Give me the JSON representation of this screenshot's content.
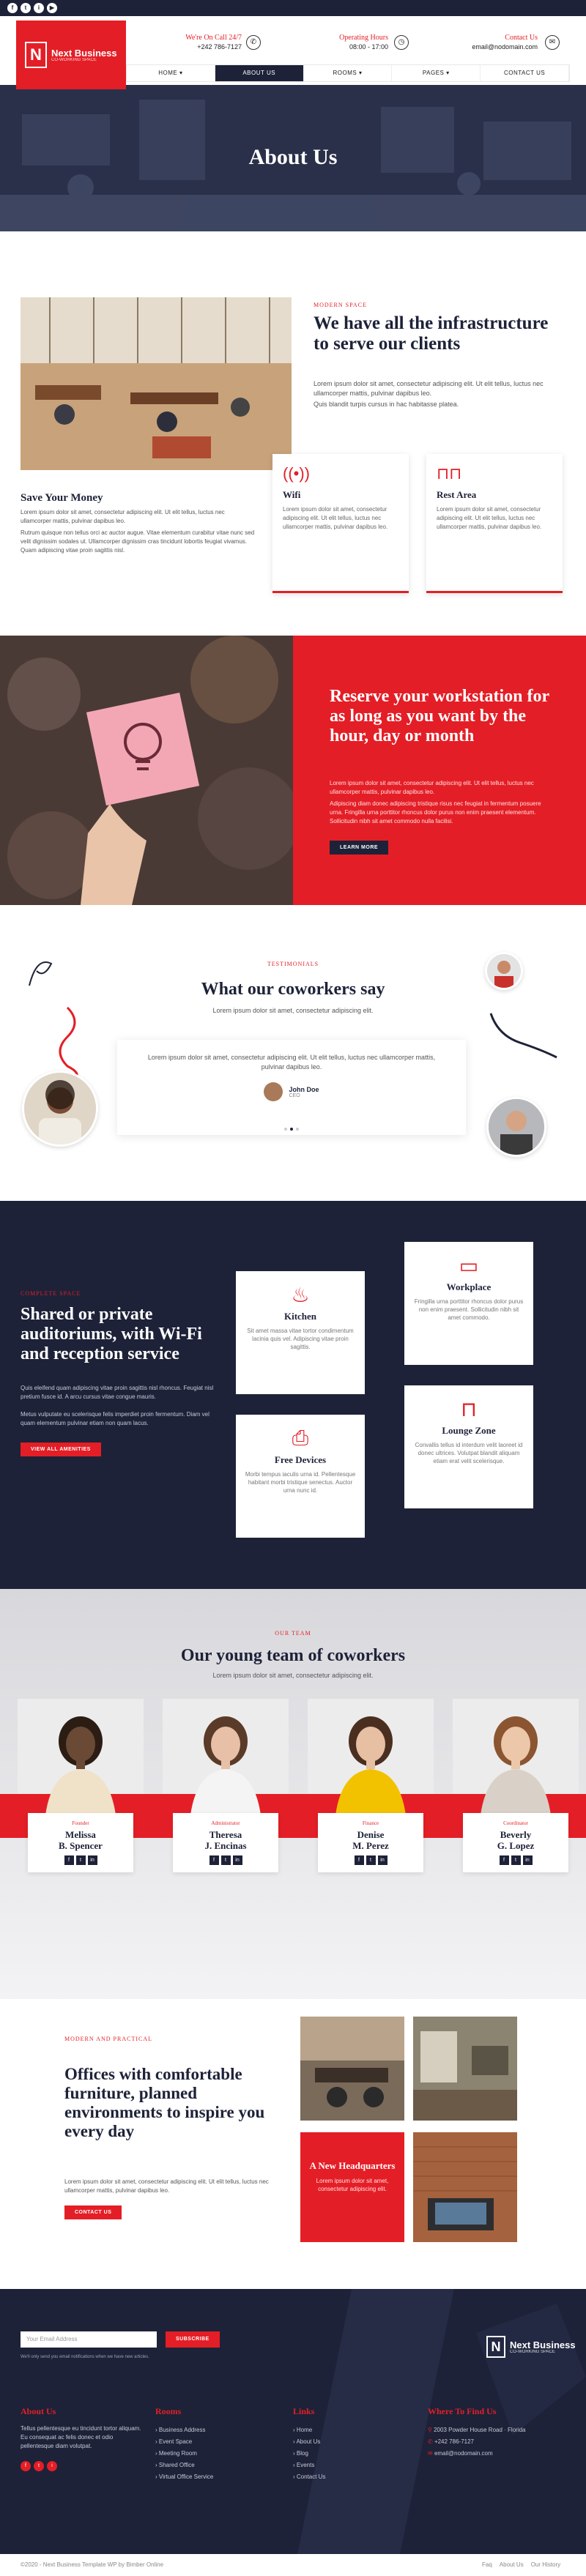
{
  "topbar": {
    "social": [
      "f",
      "t",
      "i",
      "▶"
    ]
  },
  "header": {
    "logo": {
      "title": "Next Business",
      "subtitle": "CO-WORKING SPACE"
    },
    "call": {
      "label": "We're On Call 24/7",
      "value": "+242 786-7127"
    },
    "hours": {
      "label": "Operating Hours",
      "value": "08:00 - 17:00"
    },
    "contact": {
      "label": "Contact Us",
      "value": "email@nodomain.com"
    },
    "nav": [
      {
        "label": "HOME ▾"
      },
      {
        "label": "ABOUT US"
      },
      {
        "label": "ROOMS ▾"
      },
      {
        "label": "PAGES ▾"
      },
      {
        "label": "CONTACT US"
      }
    ]
  },
  "hero": {
    "title": "About Us"
  },
  "infra": {
    "eyebrow": "MODERN SPACE",
    "title": "We have all the infrastructure to serve our clients",
    "p1": "Lorem ipsum dolor sit amet, consectetur adipiscing elit. Ut elit tellus, luctus nec ullamcorper mattis, pulvinar dapibus leo.",
    "p2": "Quis blandit turpis cursus in hac habitasse platea.",
    "money_title": "Save Your Money",
    "money_p1": "Lorem ipsum dolor sit amet, consectetur adipiscing elit. Ut elit tellus, luctus nec ullamcorper mattis, pulvinar dapibus leo.",
    "money_p2": "Rutrum quisque non tellus orci ac auctor augue. Vitae elementum curabitur vitae nunc sed velit dignissim sodales ut. Ullamcorper dignissim cras tincidunt lobortis feugiat vivamus. Quam adipiscing vitae proin sagittis nisl.",
    "cards": [
      {
        "icon": "wifi-icon",
        "glyph": "((•))",
        "title": "Wifi",
        "desc": "Lorem ipsum dolor sit amet, consectetur adipiscing elit. Ut elit tellus, luctus nec ullamcorper mattis, pulvinar dapibus leo."
      },
      {
        "icon": "sofa-icon",
        "glyph": "⊓⊓",
        "title": "Rest Area",
        "desc": "Lorem ipsum dolor sit amet, consectetur adipiscing elit. Ut elit tellus, luctus nec ullamcorper mattis, pulvinar dapibus leo."
      }
    ]
  },
  "reserve": {
    "title": "Reserve your workstation for as long as you want by the hour, day or month",
    "p1": "Lorem ipsum dolor sit amet, consectetur adipiscing elit. Ut elit tellus, luctus nec ullamcorper mattis, pulvinar dapibus leo.",
    "p2": "Adipiscing diam donec adipiscing tristique risus nec feugiat in fermentum posuere urna. Fringilla urna porttitor rhoncus dolor purus non enim praesent elementum. Sollicitudin nibh sit amet commodo nulla facilisi.",
    "button": "LEARN MORE"
  },
  "testimonials": {
    "eyebrow": "TESTIMONIALS",
    "title": "What our coworkers say",
    "subtitle": "Lorem ipsum dolor sit amet, consectetur adipiscing elit.",
    "quote": "Lorem ipsum dolor sit amet, consectetur adipiscing elit. Ut elit tellus, luctus nec ullamcorper mattis, pulvinar dapibus leo.",
    "name": "John Doe",
    "role": "CEO"
  },
  "amenities": {
    "eyebrow": "COMPLETE SPACE",
    "title": "Shared or private auditoriums, with Wi-Fi and reception service",
    "p1": "Quis eleifend quam adipiscing vitae proin sagittis nisl rhoncus. Feugiat nisl pretium fusce id. A arcu cursus vitae congue mauris.",
    "p2": "Metus vulputate eu scelerisque felis imperdiet proin fermentum. Diam vel quam elementum pulvinar etiam non quam lacus.",
    "button": "VIEW ALL AMENITIES",
    "cards": [
      {
        "icon": "kitchen-icon",
        "glyph": "♨",
        "title": "Kitchen",
        "desc": "Sit amet massa vitae tortor condimentum lacinia quis vel. Adipiscing vitae proin sagittis."
      },
      {
        "icon": "workplace-icon",
        "glyph": "▭",
        "title": "Workplace",
        "desc": "Fringilla urna porttitor rhoncus dolor purus non enim praesent. Sollicitudin nibh sit amet commodo."
      },
      {
        "icon": "printer-icon",
        "glyph": "⎙",
        "title": "Free Devices",
        "desc": "Morbi tempus iaculis urna id. Pellentesque habitant morbi tristique senectus. Auctor urna nunc id."
      },
      {
        "icon": "lounge-icon",
        "glyph": "⊓",
        "title": "Lounge Zone",
        "desc": "Convallis tellus id interdum velit laoreet id donec ultrices. Volutpat blandit aliquam etiam erat velit scelerisque."
      }
    ]
  },
  "team": {
    "eyebrow": "OUR TEAM",
    "title": "Our young team of coworkers",
    "subtitle": "Lorem ipsum dolor sit amet, consectetur adipiscing elit.",
    "members": [
      {
        "role": "Founder",
        "first": "Melissa",
        "last": "B. Spencer",
        "shirt": "#f0e2c8",
        "skin": "#6b4a35",
        "hair": "#2b1d14"
      },
      {
        "role": "Administrator",
        "first": "Theresa",
        "last": "J. Encinas",
        "shirt": "#f4f4f4",
        "skin": "#e8c0a8",
        "hair": "#5a3a28"
      },
      {
        "role": "Finance",
        "first": "Denise",
        "last": "M. Perez",
        "shirt": "#f2c200",
        "skin": "#e7bfa3",
        "hair": "#4a2f20"
      },
      {
        "role": "Coordinator",
        "first": "Beverly",
        "last": "G. Lopez",
        "shirt": "#d9d0c8",
        "skin": "#ecc7aa",
        "hair": "#8a5530"
      }
    ]
  },
  "offices": {
    "eyebrow": "MODERN AND PRACTICAL",
    "title": "Offices with comfortable furniture, planned environments to inspire you every day",
    "p": "Lorem ipsum dolor sit amet, consectetur adipiscing elit. Ut elit tellus, luctus nec ullamcorper mattis, pulvinar dapibus leo.",
    "button": "CONTACT US",
    "hq_title": "A New Headquarters",
    "hq_text": "Lorem ipsum dolor sit amet, consectetur adipiscing elit."
  },
  "footer": {
    "email_placeholder": "Your Email Address",
    "subscribe": "SUBSCRIBE",
    "disclaimer": "We'll only send you email notifications when we have new articles.",
    "about_title": "About Us",
    "about_text": "Tellus pellentesque eu tincidunt tortor aliquam. Eu consequat ac felis donec et odio pellentesque diam volutpat.",
    "rooms_title": "Rooms",
    "rooms": [
      "Business Address",
      "Event Space",
      "Meeting Room",
      "Shared Office",
      "Virtual Office Service"
    ],
    "links_title": "Links",
    "links": [
      "Home",
      "About Us",
      "Blog",
      "Events",
      "Contact Us"
    ],
    "find_title": "Where To Find Us",
    "find": [
      "2003 Powder House Road · Florida",
      "+242 786-7127",
      "email@nodomain.com"
    ],
    "copyright": "©2020 - Next Business Template WP by Bimber Online",
    "bottom_links": [
      "Faq",
      "About Us",
      "Our History"
    ]
  }
}
